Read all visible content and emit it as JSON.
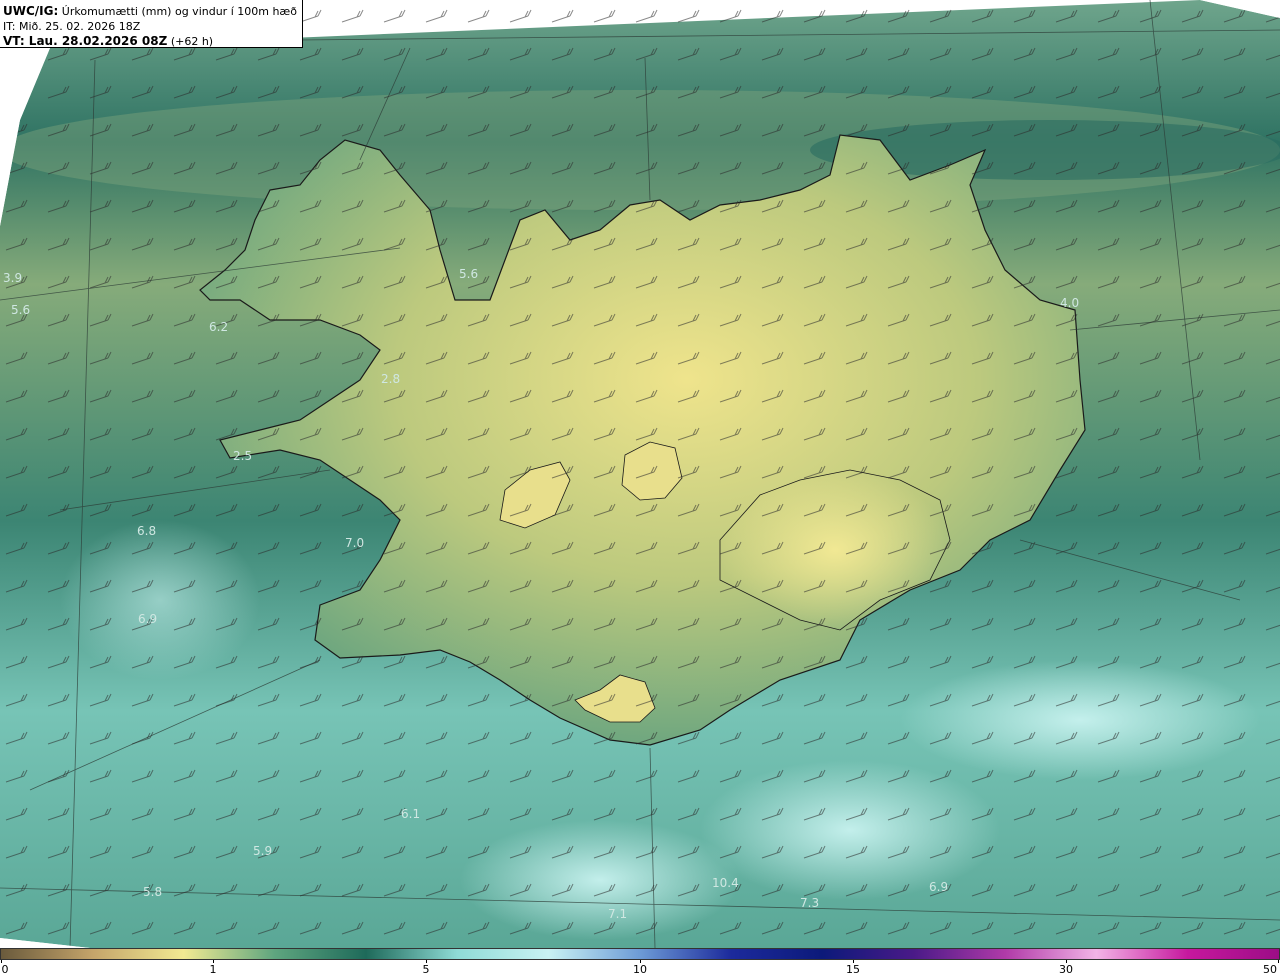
{
  "header": {
    "model_label": "UWC/IG:",
    "title": "Úrkomumætti (mm) og vindur í 100m hæð",
    "issue_time": "IT: Mið. 25. 02. 2026 18Z",
    "valid_label": "VT: Lau. 28.02.2026 08Z",
    "lead": "(+62 h)"
  },
  "colorbar": {
    "ticks": [
      "0",
      "1",
      "5",
      "10",
      "15",
      "30",
      "50"
    ],
    "stops": [
      "#6a5a3c",
      "#c4a46a",
      "#f1ea92",
      "#5ea57f",
      "#1e6a5a",
      "#8fdbd6",
      "#c9f2f3",
      "#6d9bd6",
      "#1c2a9c",
      "#0c1a7a",
      "#4a1a88",
      "#b03aa8",
      "#f2b4e6",
      "#c7189e",
      "#9c0d86"
    ]
  },
  "value_labels": [
    {
      "text": "3.9",
      "id": "v-3-9"
    },
    {
      "text": "5.6",
      "id": "v-5-6-west"
    },
    {
      "text": "6.2",
      "id": "v-6-2"
    },
    {
      "text": "5.6",
      "id": "v-5-6-north"
    },
    {
      "text": "2.8",
      "id": "v-2-8"
    },
    {
      "text": "2.5",
      "id": "v-2-5"
    },
    {
      "text": "6.8",
      "id": "v-6-8"
    },
    {
      "text": "7.0",
      "id": "v-7-0"
    },
    {
      "text": "6.9",
      "id": "v-6-9"
    },
    {
      "text": "4.0",
      "id": "v-4-0"
    },
    {
      "text": "6.1",
      "id": "v-6-1"
    },
    {
      "text": "5.9",
      "id": "v-5-9"
    },
    {
      "text": "5.8",
      "id": "v-5-8"
    },
    {
      "text": "10.4",
      "id": "v-10-4"
    },
    {
      "text": "7.3",
      "id": "v-7-3"
    },
    {
      "text": "7.1",
      "id": "v-7-1"
    },
    {
      "text": "6.9",
      "id": "v-6-9-south"
    }
  ]
}
